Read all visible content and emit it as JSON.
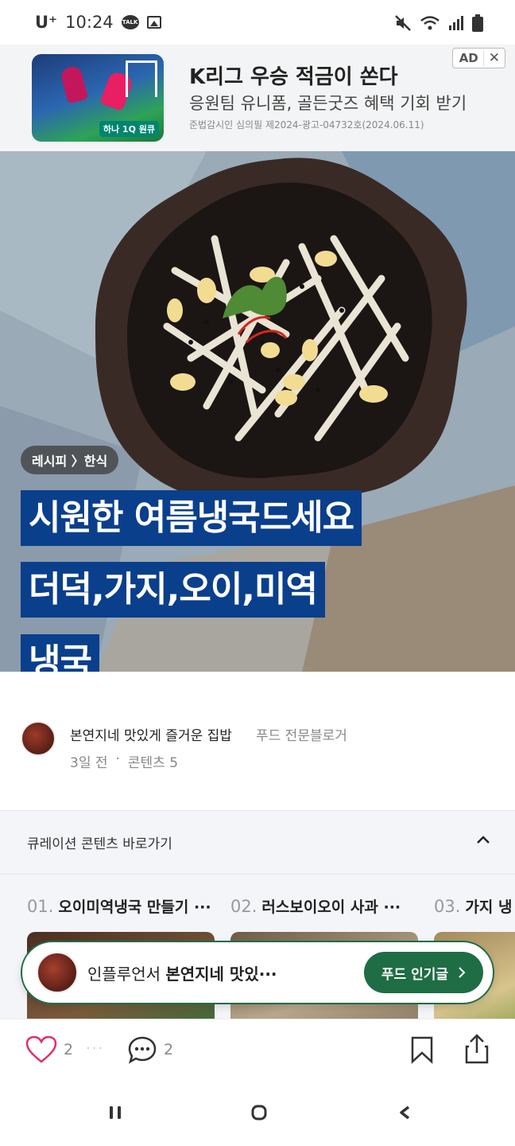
{
  "status_bar": {
    "carrier": "U⁺",
    "time": "10:24",
    "talk_label": "TALK"
  },
  "ad": {
    "title": "K리그 우승 적금이 쏜다",
    "subtitle": "응원팀 유니폼, 골든굿즈 혜택 기회 받기",
    "note": "준법감시인 심의필 제2024-광고-04732호(2024.06.11)",
    "brand": "하나 1Q 원큐",
    "badge_label": "AD",
    "close_label": "✕"
  },
  "hero": {
    "breadcrumb": "레시피 〉한식",
    "title_lines": [
      "시원한 여름냉국드세요",
      "더덕,가지,오이,미역",
      "냉국"
    ]
  },
  "author": {
    "name": "본연지네 맛있게 즐거운 집밥",
    "tag": "푸드 전문블로거",
    "time": "3일 전",
    "separator": "·",
    "contents": "콘텐츠 5"
  },
  "curation": {
    "title": "큐레이션 콘텐츠 바로가기",
    "items": [
      {
        "num": "01.",
        "title": "오이미역냉국 만들기 ···"
      },
      {
        "num": "02.",
        "title": "러스보이오이 사과 ···"
      },
      {
        "num": "03.",
        "title": "가지 냉"
      }
    ]
  },
  "influencer": {
    "prefix": "인플루언서",
    "name": "본연지네 맛있···",
    "button": "푸드 인기글"
  },
  "actions": {
    "like_count": "2",
    "dots": "···",
    "comment_count": "2"
  },
  "colors": {
    "title_bg": "#0a3f8c",
    "influencer_green": "#1f6d45",
    "like_pink": "#e0306a"
  }
}
